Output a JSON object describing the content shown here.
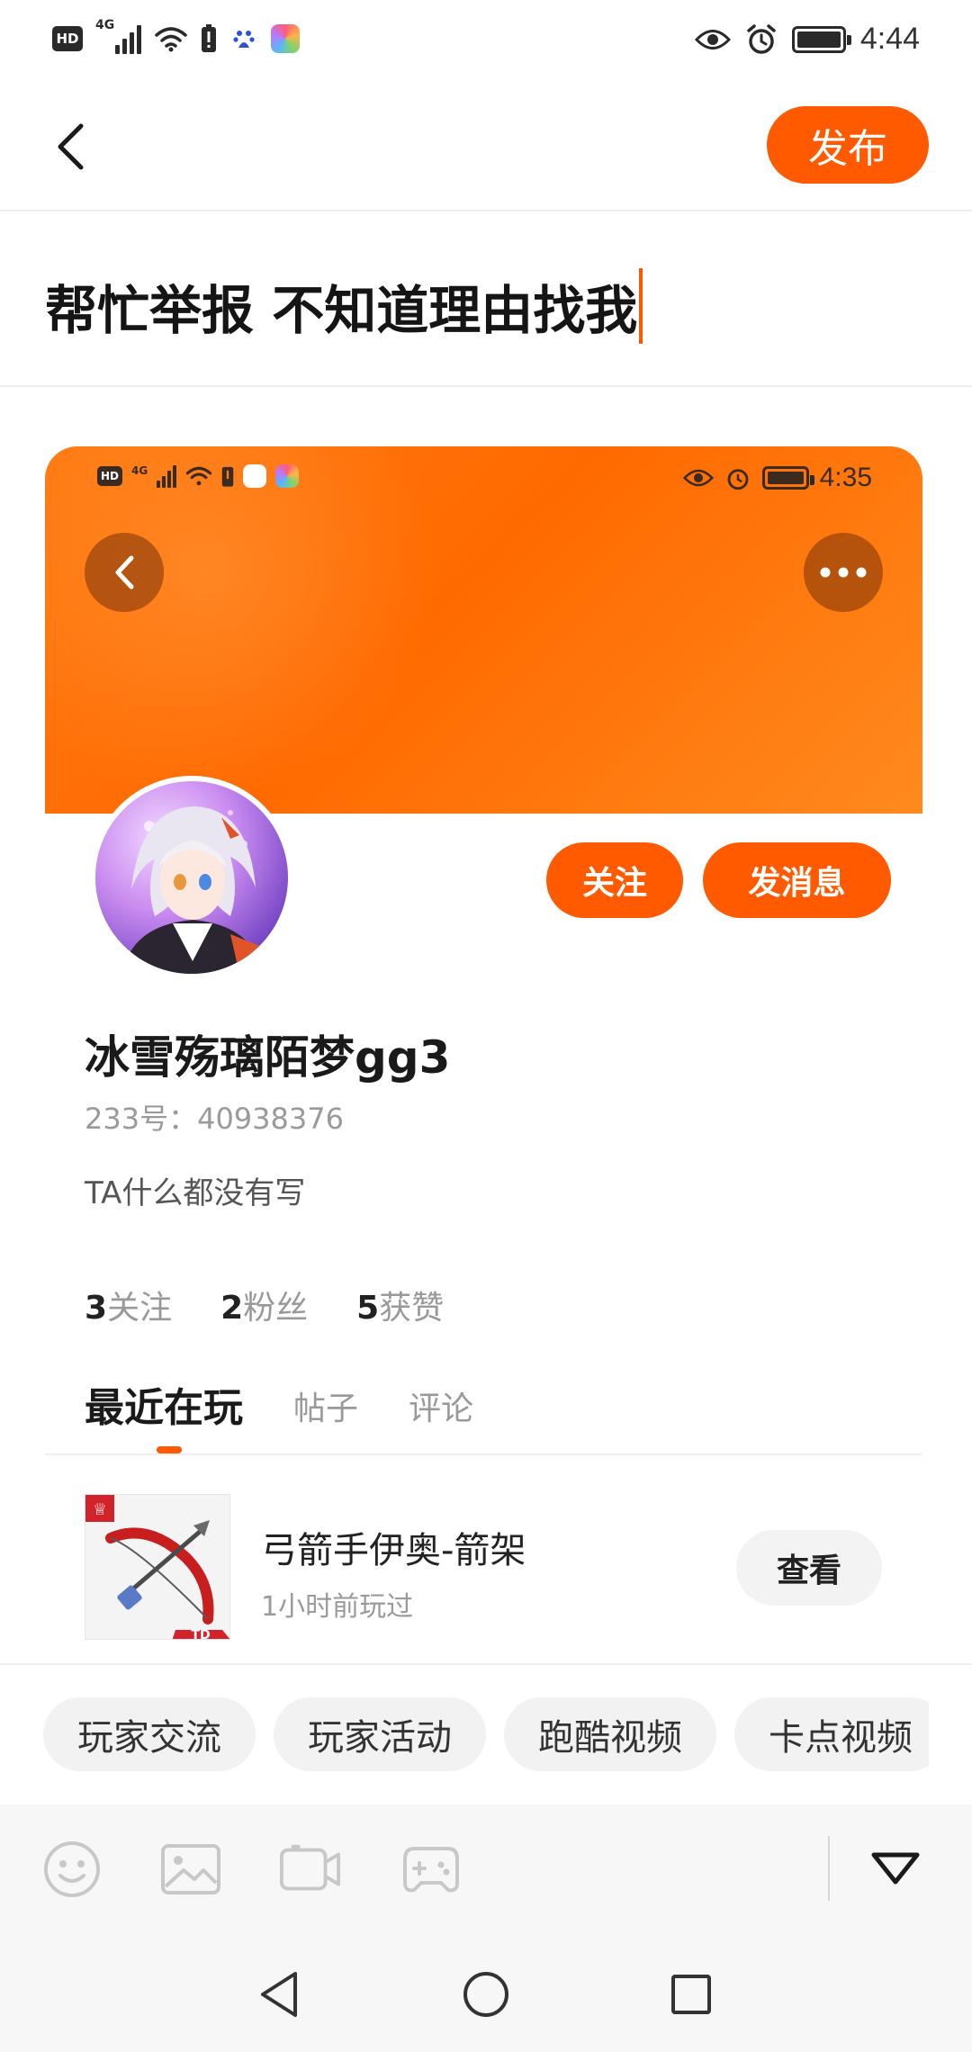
{
  "status_bar": {
    "time": "4:44",
    "hd_label": "HD",
    "network_label": "4G",
    "icons": [
      "hd-icon",
      "signal-icon",
      "wifi-icon",
      "alert-icon",
      "baidu-icon",
      "app-icon",
      "eye-icon",
      "alarm-icon",
      "battery-icon"
    ]
  },
  "header": {
    "back_icon": "chevron-left-icon",
    "publish_label": "发布"
  },
  "post": {
    "title": "帮忙举报 不知道理由找我"
  },
  "embedded_screenshot": {
    "status_time": "4:35",
    "hd_label": "HD",
    "network_label": "4G",
    "profile": {
      "follow_label": "关注",
      "message_label": "发消息",
      "username": "冰雪殇璃陌梦gg3",
      "uid": "233号：40938376",
      "bio": "TA什么都没有写",
      "stats": [
        {
          "count": "3",
          "label": "关注"
        },
        {
          "count": "2",
          "label": "粉丝"
        },
        {
          "count": "5",
          "label": "获赞"
        }
      ],
      "tabs": [
        {
          "label": "最近在玩",
          "active": true
        },
        {
          "label": "帖子",
          "active": false
        },
        {
          "label": "评论",
          "active": false
        }
      ],
      "recent_game": {
        "title": "弓箭手伊奥-箭架",
        "subtitle": "1小时前玩过",
        "view_label": "查看",
        "badge": "TD"
      }
    }
  },
  "topics": [
    "玩家交流",
    "玩家活动",
    "跑酷视频",
    "卡点视频"
  ],
  "toolbar": {
    "icons": [
      "emoji-icon",
      "image-icon",
      "video-icon",
      "game-icon",
      "collapse-icon"
    ]
  },
  "nav": {
    "icons": [
      "nav-back-icon",
      "nav-home-icon",
      "nav-recents-icon"
    ]
  },
  "colors": {
    "accent": "#ff5a00",
    "banner": "#ff7a10",
    "chip_bg": "#f2f2f2",
    "toolbar_bg": "#f7f7f7"
  }
}
